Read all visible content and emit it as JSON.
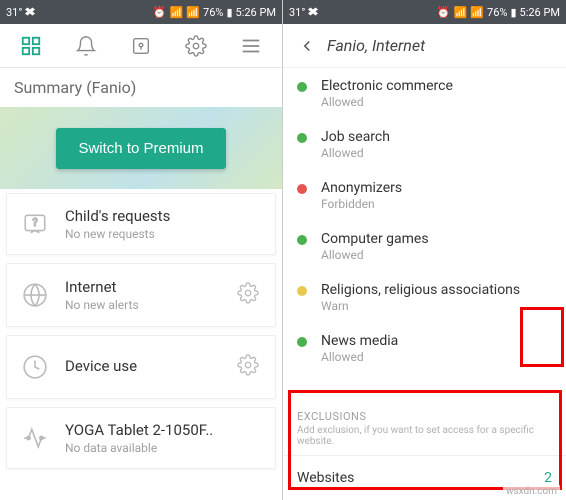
{
  "status": {
    "temp": "31°",
    "battery": "76%",
    "time": "5:26 PM"
  },
  "left": {
    "summary_header": "Summary (Fanio)",
    "premium_btn": "Switch to Premium",
    "cards": [
      {
        "title": "Child's requests",
        "sub": "No new requests"
      },
      {
        "title": "Internet",
        "sub": "No new alerts"
      },
      {
        "title": "Device use",
        "sub": ""
      },
      {
        "title": "YOGA Tablet 2-1050F..",
        "sub": "No data available"
      }
    ]
  },
  "right": {
    "title": "Fanio, Internet",
    "categories": [
      {
        "dot": "dot-green",
        "title": "Electronic commerce",
        "status": "Allowed"
      },
      {
        "dot": "dot-green",
        "title": "Job search",
        "status": "Allowed"
      },
      {
        "dot": "dot-red",
        "title": "Anonymizers",
        "status": "Forbidden"
      },
      {
        "dot": "dot-green",
        "title": "Computer games",
        "status": "Allowed"
      },
      {
        "dot": "dot-yellow",
        "title": "Religions, religious associations",
        "status": "Warn"
      },
      {
        "dot": "dot-green",
        "title": "News media",
        "status": "Allowed"
      }
    ],
    "exclusions_header": "EXCLUSIONS",
    "exclusions_hint": "Add exclusion, if you want to set access for a specific website.",
    "websites_label": "Websites",
    "websites_count": "2"
  },
  "watermark": "wsxdn.com"
}
